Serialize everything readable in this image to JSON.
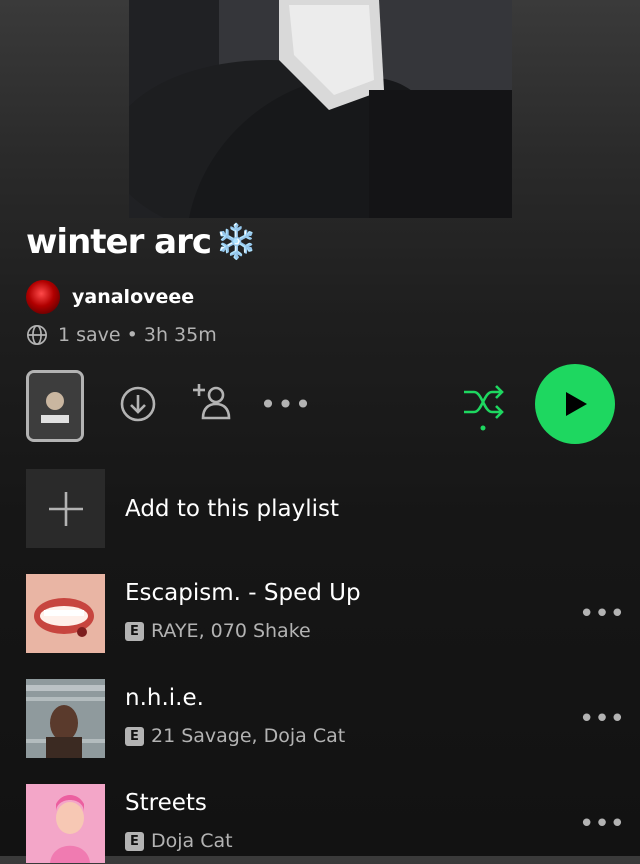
{
  "playlist": {
    "title": "winter arc",
    "title_emoji": "❄️",
    "owner": "yanaloveee",
    "meta": "1 save • 3h 35m"
  },
  "controls": {
    "icons": [
      "download-icon",
      "follow-icon",
      "more-icon",
      "shuffle-icon",
      "play-icon"
    ],
    "more_label": "•••"
  },
  "add_row": {
    "label": "Add to this playlist"
  },
  "tracks": [
    {
      "title": "Escapism. - Sped Up",
      "artists": "RAYE, 070 Shake",
      "explicit": "E",
      "options": "•••"
    },
    {
      "title": "n.h.i.e.",
      "artists": "21 Savage, Doja Cat",
      "explicit": "E",
      "options": "•••"
    },
    {
      "title": "Streets",
      "artists": "Doja Cat",
      "explicit": "E",
      "options": "•••"
    }
  ],
  "colors": {
    "accent": "#1ed760",
    "text_secondary": "#b3b3b3",
    "background": "#121212"
  }
}
